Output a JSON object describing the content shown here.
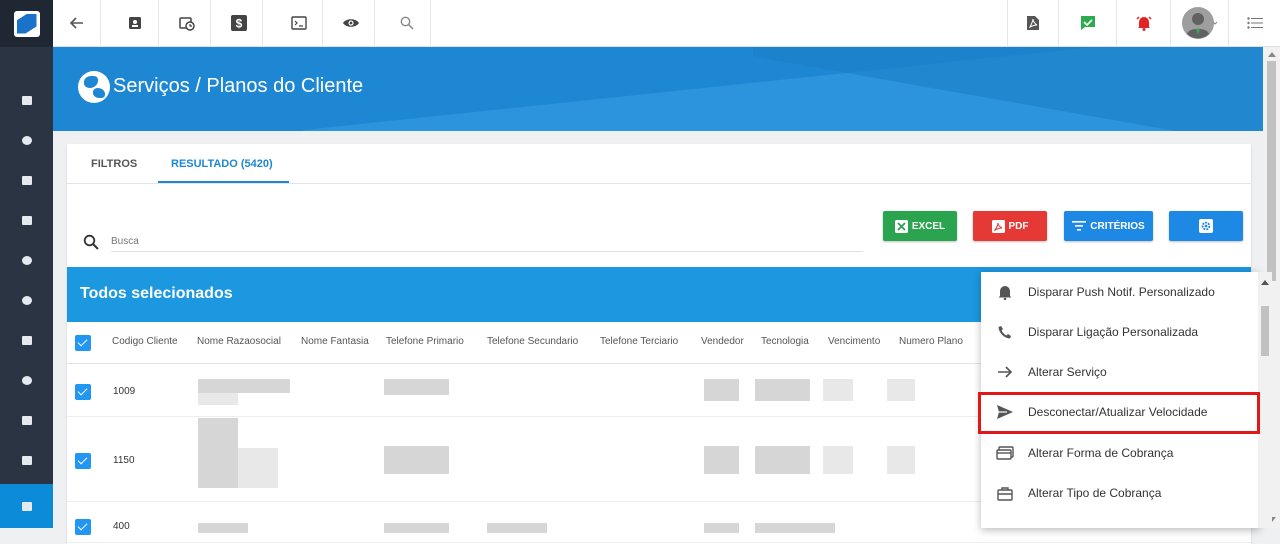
{
  "page": {
    "title": "Serviços / Planos do Cliente"
  },
  "tabs": [
    {
      "label": "FILTROS"
    },
    {
      "label": "RESULTADO (5420)"
    }
  ],
  "search": {
    "placeholder": "Busca"
  },
  "actions": {
    "excel": "EXCEL",
    "pdf": "PDF",
    "criteria": "CRITÉRIOS"
  },
  "selection": {
    "label": "Todos selecionados"
  },
  "table": {
    "columns": [
      "Codigo Cliente",
      "Nome Razaosocial",
      "Nome Fantasia",
      "Telefone Primario",
      "Telefone Secundario",
      "Telefone Terciario",
      "Vendedor",
      "Tecnologia",
      "Vencimento",
      "Numero Plano"
    ],
    "rows": [
      {
        "codigo": "1009"
      },
      {
        "codigo": "1150"
      },
      {
        "codigo": "400"
      }
    ]
  },
  "menu": {
    "items": [
      {
        "label": "Disparar Push Notif. Personalizado",
        "icon": "bell-icon"
      },
      {
        "label": "Disparar Ligação Personalizada",
        "icon": "phone-icon"
      },
      {
        "label": "Alterar Serviço",
        "icon": "arrow-right-icon"
      },
      {
        "label": "Desconectar/Atualizar Velocidade",
        "icon": "send-icon",
        "highlighted": true
      },
      {
        "label": "Alterar Forma de Cobrança",
        "icon": "billing-icon"
      },
      {
        "label": "Alterar Tipo de Cobrança",
        "icon": "briefcase-icon"
      }
    ]
  },
  "colors": {
    "accent": "#1e87d3",
    "sidebar": "#2b3443",
    "excel": "#2aa44f",
    "pdf": "#e53935",
    "criteria": "#1e88e5",
    "highlight": "#e01818"
  }
}
